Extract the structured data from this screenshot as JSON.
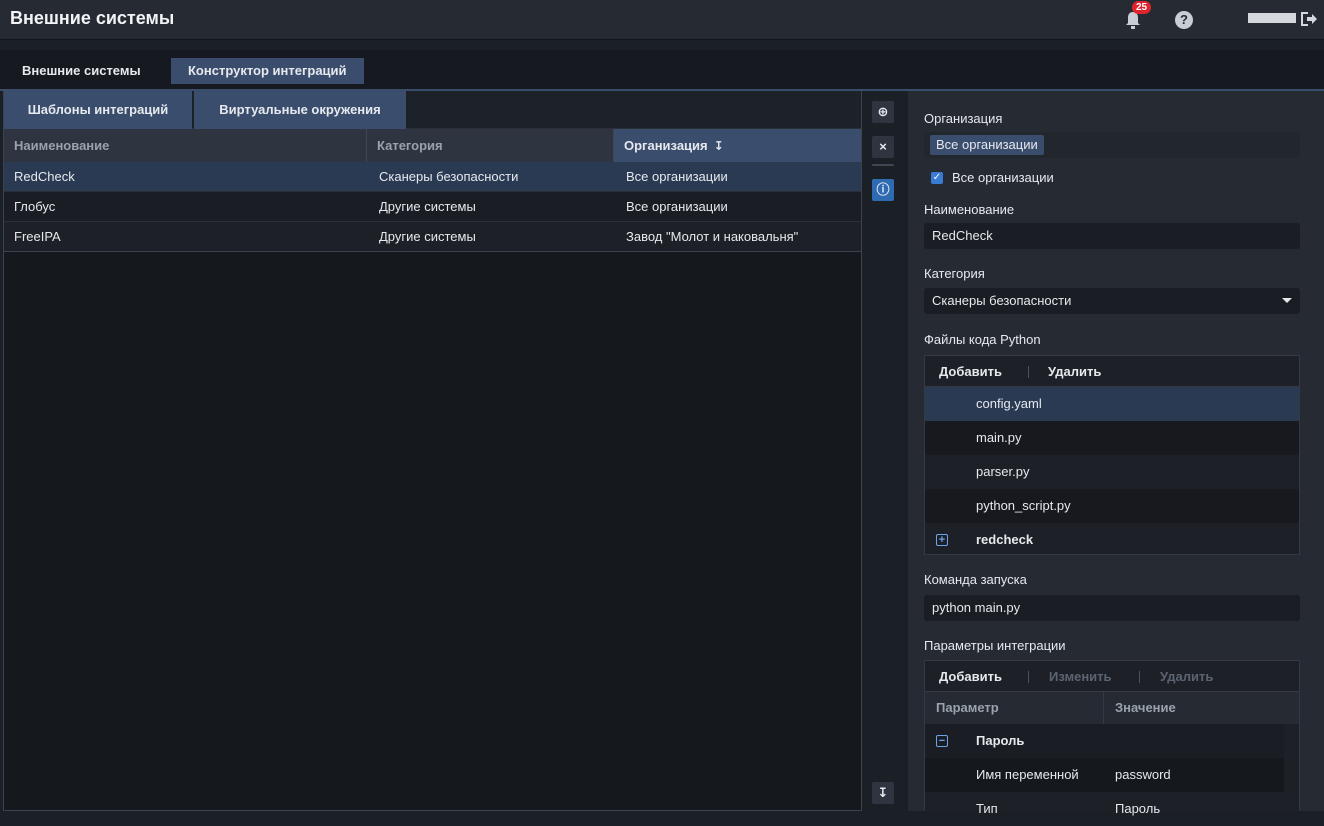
{
  "header": {
    "title": "Внешние системы",
    "notification_count": "25"
  },
  "tabs": {
    "main": [
      "Внешние системы",
      "Конструктор интеграций"
    ],
    "sub": [
      "Шаблоны интеграций",
      "Виртуальные окружения"
    ]
  },
  "table": {
    "columns": [
      "Наименование",
      "Категория",
      "Организация"
    ],
    "rows": [
      {
        "name": "RedCheck",
        "category": "Сканеры безопасности",
        "org": "Все организации"
      },
      {
        "name": "Глобус",
        "category": "Другие системы",
        "org": "Все организации"
      },
      {
        "name": "FreeIPA",
        "category": "Другие системы",
        "org": "Завод \"Молот и наковальня\""
      }
    ]
  },
  "form": {
    "org_label": "Организация",
    "org_chip": "Все организации",
    "all_orgs_checkbox": "Все организации",
    "name_label": "Наименование",
    "name_value": "RedCheck",
    "category_label": "Категория",
    "category_value": "Сканеры безопасности",
    "files_label": "Файлы кода Python",
    "files_toolbar": {
      "add": "Добавить",
      "delete": "Удалить"
    },
    "files": [
      "config.yaml",
      "main.py",
      "parser.py",
      "python_script.py"
    ],
    "folder": "redcheck",
    "command_label": "Команда запуска",
    "command_value": "python main.py",
    "params_label": "Параметры интеграции",
    "params_toolbar": {
      "add": "Добавить",
      "edit": "Изменить",
      "delete": "Удалить"
    },
    "params_columns": [
      "Параметр",
      "Значение"
    ],
    "params_group": "Пароль",
    "params_rows": [
      {
        "param": "Имя переменной",
        "value": "password"
      },
      {
        "param": "Тип",
        "value": "Пароль"
      }
    ]
  },
  "icons": [
    "bell-icon",
    "help-icon",
    "logout-icon",
    "add-icon",
    "close-icon",
    "info-icon",
    "sort-icon",
    "expand-icon",
    "collapse-icon",
    "checkbox-checked-icon",
    "dropdown-caret-icon"
  ]
}
